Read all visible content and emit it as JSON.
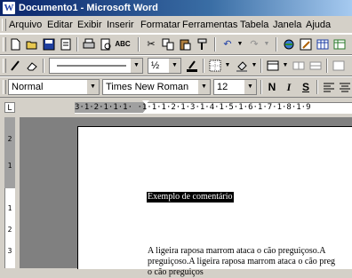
{
  "window": {
    "title": "Documento1 - Microsoft Word"
  },
  "menu": [
    "Arquivo",
    "Editar",
    "Exibir",
    "Inserir",
    "Formatar",
    "Ferramentas",
    "Tabela",
    "Janela",
    "Ajuda"
  ],
  "toolbar_standard": {
    "icons": [
      "new-document-icon",
      "open-folder-icon",
      "save-icon",
      "email-icon",
      "print-icon",
      "print-preview-icon",
      "spelling-icon",
      "cut-icon",
      "copy-icon",
      "paste-icon",
      "format-painter-icon",
      "undo-icon",
      "redo-icon",
      "hyperlink-icon",
      "tables-borders-icon",
      "insert-table-icon",
      "insert-excel-icon"
    ]
  },
  "toolbar_drawing": {
    "line_weight": "½",
    "icons": [
      "pen-icon",
      "eraser-icon",
      "line-style-combo",
      "line-color-icon",
      "border-icon",
      "shading-icon",
      "insert-table-icon",
      "align-icon",
      "distribute-icon"
    ]
  },
  "formatting": {
    "style": "Normal",
    "font": "Times New Roman",
    "size": "12",
    "bold": "N",
    "italic": "I",
    "underline": "S"
  },
  "ruler": {
    "h_text": "3·1·2·1·1·1· ·1·1·1·2·1·3·1·4·1·5·1·6·1·7·1·8·1·9",
    "v_numbers": [
      "2",
      "1",
      "1",
      "2",
      "3"
    ],
    "tab_marker": "L"
  },
  "document": {
    "comment_selected": "Exemplo de comentário",
    "paragraph_lines": [
      "A ligeira raposa marrom ataca o cão preguiçoso.A",
      "preguiçoso.A ligeira raposa marrom ataca o cão preg",
      "o cão preguiços"
    ]
  }
}
